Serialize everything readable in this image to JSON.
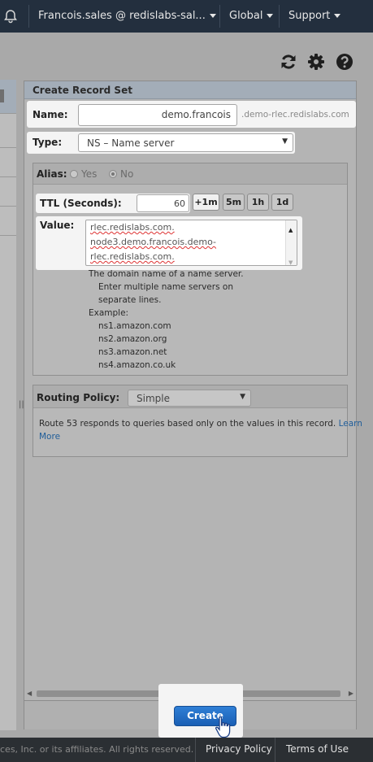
{
  "topnav": {
    "account": "Francois.sales @ redislabs-sal...",
    "region": "Global",
    "support": "Support"
  },
  "dialog": {
    "title": "Create Record Set",
    "name_label": "Name:",
    "name_value": "demo.francois",
    "name_suffix": ".demo-rlec.redislabs.com",
    "type_label": "Type:",
    "type_value": "NS – Name server",
    "alias_label": "Alias:",
    "alias_yes": "Yes",
    "alias_no": "No",
    "ttl_label": "TTL (Seconds):",
    "ttl_value": "60",
    "ttl_buttons": [
      "+1m",
      "5m",
      "1h",
      "1d"
    ],
    "value_label": "Value:",
    "value_lines": [
      "rlec.redislabs.com.",
      "node3.demo.francois.demo-",
      "rlec.redislabs.com."
    ],
    "help_lines": [
      "The domain name of a name server.",
      "Enter multiple name servers on",
      "separate lines.",
      "Example:",
      "ns1.amazon.com",
      "ns2.amazon.org",
      "ns3.amazon.net",
      "ns4.amazon.co.uk"
    ],
    "routing_label": "Routing Policy:",
    "routing_value": "Simple",
    "routing_desc": "Route 53 responds to queries based only on the values in this record.",
    "learn_more_1": "Learn",
    "learn_more_2": "More",
    "create_label": "Create"
  },
  "footer": {
    "copyright": "ces, Inc. or its affiliates. All rights reserved.",
    "privacy": "Privacy Policy",
    "terms": "Terms of Use"
  }
}
